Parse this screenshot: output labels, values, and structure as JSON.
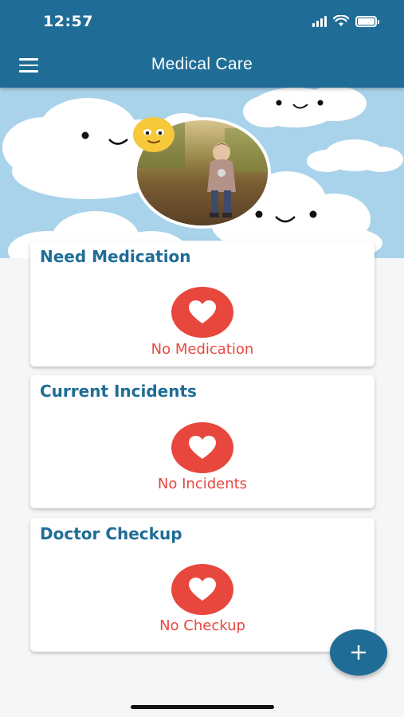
{
  "status_bar": {
    "time": "12:57",
    "icons": [
      "signal-icon",
      "wifi-icon",
      "battery-icon"
    ]
  },
  "app_bar": {
    "title": "Medical Care",
    "menu_icon": "hamburger-menu-icon"
  },
  "profile": {
    "photo_alt": "child-photo"
  },
  "cards": [
    {
      "title": "Need Medication",
      "status": "No Medication",
      "icon": "heart-icon"
    },
    {
      "title": "Current Incidents",
      "status": "No Incidents",
      "icon": "heart-icon"
    },
    {
      "title": "Doctor Checkup",
      "status": "No Checkup",
      "icon": "heart-icon"
    }
  ],
  "fab": {
    "label": "+",
    "icon": "plus-icon"
  },
  "colors": {
    "primary": "#1f6d96",
    "accent": "#e8473e",
    "sky": "#a9d3ea",
    "background": "#f5f6f7"
  }
}
